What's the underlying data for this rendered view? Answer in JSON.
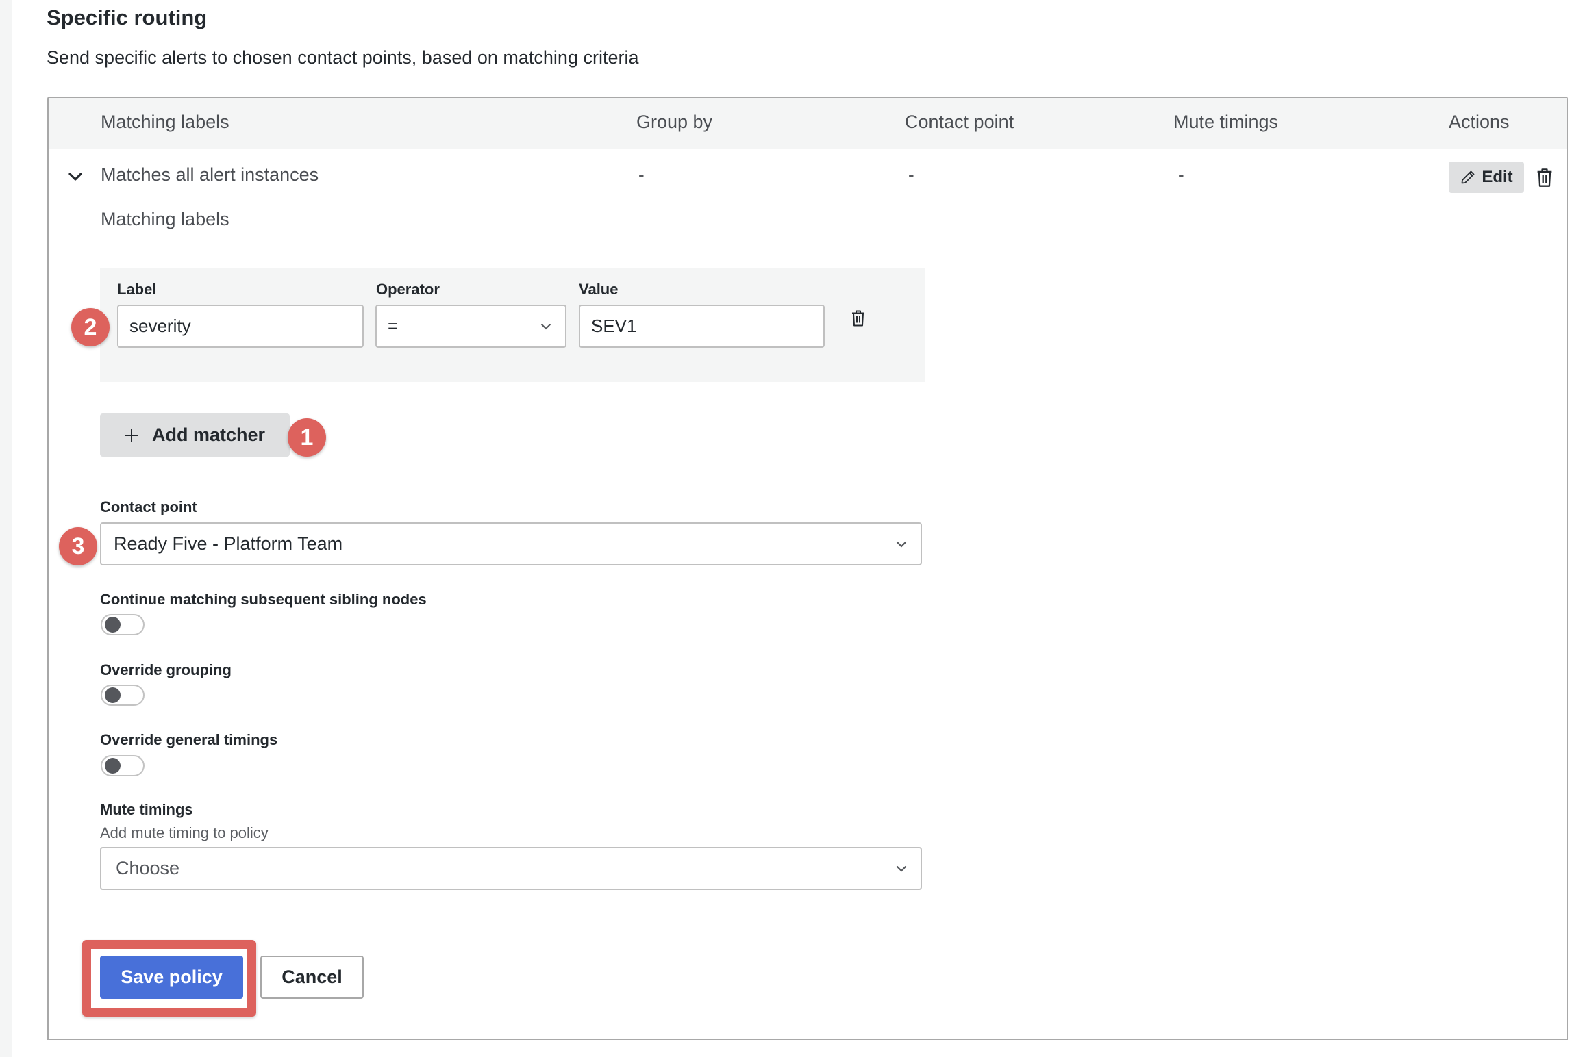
{
  "section": {
    "title": "Specific routing",
    "description": "Send specific alerts to chosen contact points, based on matching criteria"
  },
  "table": {
    "columns": [
      "Matching labels",
      "Group by",
      "Contact point",
      "Mute timings",
      "Actions"
    ],
    "row": {
      "matching_labels": "Matches all alert instances",
      "group_by": "-",
      "contact_point": "-",
      "mute_timings": "-",
      "edit_label": "Edit",
      "expanded": true
    }
  },
  "editor": {
    "matching_labels_heading": "Matching labels",
    "matcher": {
      "label_header": "Label",
      "operator_header": "Operator",
      "value_header": "Value",
      "label_value": "severity",
      "operator_value": "=",
      "value_value": "SEV1"
    },
    "add_matcher_label": "Add matcher",
    "contact_point": {
      "label": "Contact point",
      "selected": "Ready Five - Platform Team"
    },
    "toggles": [
      {
        "label": "Continue matching subsequent sibling nodes",
        "on": false
      },
      {
        "label": "Override grouping",
        "on": false
      },
      {
        "label": "Override general timings",
        "on": false
      }
    ],
    "mute_timings": {
      "label": "Mute timings",
      "description": "Add mute timing to policy",
      "placeholder": "Choose"
    },
    "save_label": "Save policy",
    "cancel_label": "Cancel"
  },
  "annotations": {
    "badge_1": "1",
    "badge_2": "2",
    "badge_3": "3",
    "color": "#dd625d"
  },
  "colors": {
    "primary": "#4870d9",
    "header_bg": "#f4f5f5",
    "secondary_button_bg": "#dfe0e1"
  }
}
